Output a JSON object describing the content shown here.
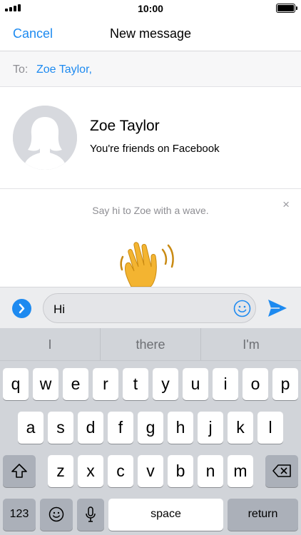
{
  "status_bar": {
    "time": "10:00",
    "signal_bars": 4,
    "battery_level": 1.0
  },
  "nav": {
    "cancel_label": "Cancel",
    "title": "New message"
  },
  "recipient": {
    "to_label": "To:",
    "value": "Zoe Taylor,"
  },
  "profile": {
    "name": "Zoe Taylor",
    "subtitle": "You're friends on Facebook",
    "avatar_icon": "person-silhouette-icon"
  },
  "wave": {
    "prompt": "Say hi to Zoe with a wave.",
    "close_symbol": "×",
    "emoji": "waving-hand"
  },
  "composer": {
    "text": "Hi",
    "expand_icon": "chevron-right-icon",
    "emoji_icon": "smiley-icon",
    "send_icon": "send-arrow-icon"
  },
  "keyboard": {
    "suggestions": [
      "I",
      "there",
      "I'm"
    ],
    "row1": [
      "q",
      "w",
      "e",
      "r",
      "t",
      "y",
      "u",
      "i",
      "o",
      "p"
    ],
    "row2": [
      "a",
      "s",
      "d",
      "f",
      "g",
      "h",
      "j",
      "k",
      "l"
    ],
    "row3": [
      "z",
      "x",
      "c",
      "v",
      "b",
      "n",
      "m"
    ],
    "numbers_label": "123",
    "space_label": "space",
    "return_label": "return",
    "shift_icon": "shift-icon",
    "delete_icon": "backspace-icon",
    "emoji_icon": "emoji-key-icon",
    "mic_icon": "microphone-icon"
  },
  "colors": {
    "accent": "#1d8af0",
    "keyboard_bg": "#d1d4d9",
    "dark_key": "#abb0b9"
  }
}
